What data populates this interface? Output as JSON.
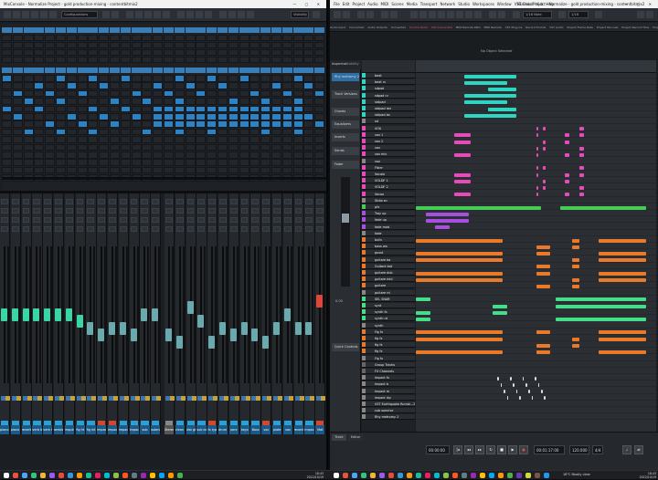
{
  "mixer": {
    "title": "MixConsole - Normalize Project - gold production-mixing - contentbitmix2",
    "toolbar": {
      "config_label": "Configurations",
      "visibility_label": "Visibility"
    },
    "routing_rows": 8,
    "channels": [
      {
        "name": "piano ver",
        "color": "#2aa0d8",
        "fader": 0.55,
        "active": true
      },
      {
        "name": "piano ver",
        "color": "#2aa0d8",
        "fader": 0.55,
        "active": true
      },
      {
        "name": "reverb b",
        "color": "#2aa0d8",
        "fader": 0.55,
        "active": true
      },
      {
        "name": "verb bat",
        "color": "#2aa0d8",
        "fader": 0.55,
        "active": true
      },
      {
        "name": "verb hst",
        "color": "#2aa0d8",
        "fader": 0.55,
        "active": true
      },
      {
        "name": "ambience",
        "color": "#2aa0d8",
        "fader": 0.55,
        "active": true
      },
      {
        "name": "impuls",
        "color": "#2aa0d8",
        "fader": 0.55,
        "active": true
      },
      {
        "name": "fig ht",
        "color": "#2aa0d8",
        "fader": 0.5,
        "active": true
      },
      {
        "name": "fig int",
        "color": "#2aa0d8",
        "fader": 0.45,
        "active": false
      },
      {
        "name": "impact fx",
        "color": "#d4462d",
        "fader": 0.4,
        "active": false
      },
      {
        "name": "impact b",
        "color": "#d4462d",
        "fader": 0.45,
        "active": false
      },
      {
        "name": "impact fb",
        "color": "#2aa0d8",
        "fader": 0.45,
        "active": false
      },
      {
        "name": "impact m",
        "color": "#2aa0d8",
        "fader": 0.4,
        "active": false
      },
      {
        "name": "sub",
        "color": "#2aa0d8",
        "fader": 0.55,
        "active": false
      },
      {
        "name": "submaster",
        "color": "#2aa0d8",
        "fader": 0.55,
        "active": false
      },
      {
        "name": "Stereo Out",
        "color": "#888888",
        "fader": 0.4,
        "active": false
      },
      {
        "name": "clean gtr",
        "color": "#2aa0d8",
        "fader": 0.35,
        "active": false
      },
      {
        "name": "dist gtr",
        "color": "#2aa0d8",
        "fader": 0.6,
        "active": false
      },
      {
        "name": "sub bass",
        "color": "#2aa0d8",
        "fader": 0.5,
        "active": false
      },
      {
        "name": "fx typ",
        "color": "#d4462d",
        "fader": 0.35,
        "active": false
      },
      {
        "name": "drum loop",
        "color": "#2aa0d8",
        "fader": 0.45,
        "active": false
      },
      {
        "name": "perc",
        "color": "#2aa0d8",
        "fader": 0.4,
        "active": false
      },
      {
        "name": "keys",
        "color": "#2aa0d8",
        "fader": 0.45,
        "active": false
      },
      {
        "name": "Bass",
        "color": "#2aa0d8",
        "fader": 0.4,
        "active": false
      },
      {
        "name": "voc",
        "color": "#d4462d",
        "fader": 0.35,
        "active": false
      },
      {
        "name": "plate",
        "color": "#2aa0d8",
        "fader": 0.45,
        "active": false
      },
      {
        "name": "vox",
        "color": "#2aa0d8",
        "fader": 0.55,
        "active": false
      },
      {
        "name": "reverb",
        "color": "#2aa0d8",
        "fader": 0.45,
        "active": false
      },
      {
        "name": "impact b",
        "color": "#2aa0d8",
        "fader": 0.45,
        "active": false
      },
      {
        "name": "Mat",
        "color": "#d4462d",
        "fader": 0.65,
        "active": true
      }
    ]
  },
  "project": {
    "title": "Nuendo Project - Normalize - gold production-mixing - contentbitmix2",
    "menu": [
      "File",
      "Edit",
      "Project",
      "Audio",
      "MIDI",
      "Scores",
      "Media",
      "Transport",
      "Network",
      "Studio",
      "Workspaces",
      "Window",
      "VST Cloud",
      "Hub",
      "Help"
    ],
    "tabs": [
      "Audio Input",
      "Connected",
      "Audio Outputs",
      "Connected",
      "Control Room",
      "Not Connected",
      "MIDI Remote Path",
      "MIDI Remote",
      "VST Plug-ins",
      "Record Format",
      "VST Audio",
      "Project Frame Rate",
      "Project Pan Law",
      "Project Record Time",
      "Project Pan Law",
      "Punch Point"
    ],
    "no_object": "No Object Selected",
    "inspector": {
      "tabs": [
        "Inspector",
        "Visibility"
      ],
      "items": [
        "Rhy metromy 2",
        "Track Versions",
        "Chords",
        "Equalizers",
        "Inserts",
        "Sends",
        "Fader",
        "Quick Controls"
      ]
    },
    "tracks": [
      {
        "name": "beat",
        "color": "#2ed5c0"
      },
      {
        "name": "beat rv",
        "color": "#2ed5c0"
      },
      {
        "name": "sdpad",
        "color": "#2ed5c0"
      },
      {
        "name": "sdpad rv",
        "color": "#2ed5c0"
      },
      {
        "name": "stdpad",
        "color": "#2ed5c0"
      },
      {
        "name": "stdpad rev",
        "color": "#2ed5c0"
      },
      {
        "name": "stdpad bs",
        "color": "#2ed5c0"
      },
      {
        "name": "sd",
        "color": "#888888"
      },
      {
        "name": "VOX",
        "color": "#e64bb9"
      },
      {
        "name": "vox 1",
        "color": "#e64bb9"
      },
      {
        "name": "vox 2",
        "color": "#e64bb9"
      },
      {
        "name": "vox",
        "color": "#e64bb9"
      },
      {
        "name": "vox mix",
        "color": "#e64bb9"
      },
      {
        "name": "vox",
        "color": "#888888"
      },
      {
        "name": "Fisler",
        "color": "#e64bb9"
      },
      {
        "name": "Vocalo",
        "color": "#e64bb9"
      },
      {
        "name": "VOLDF 1",
        "color": "#e64bb9"
      },
      {
        "name": "VOLDF 2",
        "color": "#e64bb9"
      },
      {
        "name": "Vocoo",
        "color": "#e64bb9"
      },
      {
        "name": "Stdio sn",
        "color": "#888888"
      },
      {
        "name": "pfx",
        "color": "#44cc55"
      },
      {
        "name": "Tray up",
        "color": "#a64fe0"
      },
      {
        "name": "fade up",
        "color": "#a64fe0"
      },
      {
        "name": "fade mod",
        "color": "#a64fe0"
      },
      {
        "name": "fade",
        "color": "#888888"
      },
      {
        "name": "bulls",
        "color": "#ea7a2a"
      },
      {
        "name": "bass wa",
        "color": "#ea7a2a"
      },
      {
        "name": "gusst",
        "color": "#ea7a2a"
      },
      {
        "name": "guitare ba",
        "color": "#ea7a2a"
      },
      {
        "name": "Guitare bat",
        "color": "#ea7a2a"
      },
      {
        "name": "guitare dub",
        "color": "#ea7a2a"
      },
      {
        "name": "guitare mid",
        "color": "#ea7a2a"
      },
      {
        "name": "guitare",
        "color": "#ea7a2a"
      },
      {
        "name": "guitare rd",
        "color": "#888888"
      },
      {
        "name": "SEL SNAR",
        "color": "#44dd88"
      },
      {
        "name": "synt",
        "color": "#44dd88"
      },
      {
        "name": "synth fx",
        "color": "#44dd88"
      },
      {
        "name": "synth rd",
        "color": "#44dd88"
      },
      {
        "name": "synth",
        "color": "#888888"
      },
      {
        "name": "Fig fx",
        "color": "#ea7a2a"
      },
      {
        "name": "fig fx",
        "color": "#ea7a2a"
      },
      {
        "name": "fig fx",
        "color": "#ea7a2a"
      },
      {
        "name": "fig fx",
        "color": "#ea7a2a"
      },
      {
        "name": "Fig fx",
        "color": "#888888"
      },
      {
        "name": "Group Tracks",
        "color": "#666666"
      },
      {
        "name": "FX Channels",
        "color": "#666666"
      },
      {
        "name": "impact fx",
        "color": "#888888"
      },
      {
        "name": "impact b",
        "color": "#888888"
      },
      {
        "name": "impact m",
        "color": "#888888"
      },
      {
        "name": "impact rtp",
        "color": "#888888"
      },
      {
        "name": "VST Earthquake Rumbl...27",
        "color": "#888888"
      },
      {
        "name": "sub sonnive",
        "color": "#888888"
      },
      {
        "name": "Rhy metromy 2",
        "color": "#888888"
      }
    ],
    "bottom_tabs": [
      "Track",
      "Editor"
    ],
    "transport": {
      "position": "00:00:00",
      "right_position": "00:01:17:00",
      "tempo": "120.000",
      "signature": "4/4"
    }
  },
  "taskbar": {
    "left_clock_time": "18:43",
    "left_clock_date": "2022/10/19",
    "right_clock_time": "18:43",
    "right_clock_date": "2022/10/19",
    "weather": "18°C Mostly clear"
  }
}
